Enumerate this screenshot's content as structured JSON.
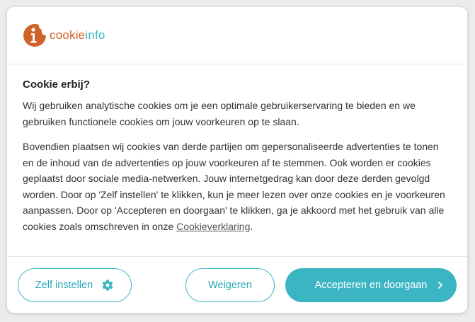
{
  "logo": {
    "text_part1": "cookie",
    "text_part2": "info"
  },
  "dialog": {
    "title": "Cookie erbij?",
    "paragraph1": "Wij gebruiken analytische cookies om je een optimale gebruikerservaring te bieden en we gebruiken functionele cookies om jouw voorkeuren op te slaan.",
    "paragraph2": "Bovendien plaatsen wij cookies van derde partijen om gepersonaliseerde advertenties te tonen en de inhoud van de advertenties op jouw voorkeuren af te stemmen. Ook worden er cookies geplaatst door sociale media-netwerken. Jouw internetgedrag kan door deze derden gevolgd worden. Door op 'Zelf instellen' te klikken, kun je meer lezen over onze cookies en je voorkeuren aanpassen. Door op 'Accepteren en doorgaan' te klikken, ga je akkoord met het gebruik van alle cookies zoals omschreven in onze ",
    "link_text": "Cookieverklaring",
    "paragraph2_end": "."
  },
  "buttons": {
    "self_settings_label": "Zelf instellen",
    "refuse_label": "Weigeren",
    "accept_label": "Accepteren en doorgaan"
  },
  "icons": {
    "logo": "cookieinfo-logo-icon",
    "gear": "gear-icon",
    "chevron": "chevron-right-icon"
  },
  "colors": {
    "accent": "#3cb5c3",
    "logo_orange": "#d0632a"
  }
}
